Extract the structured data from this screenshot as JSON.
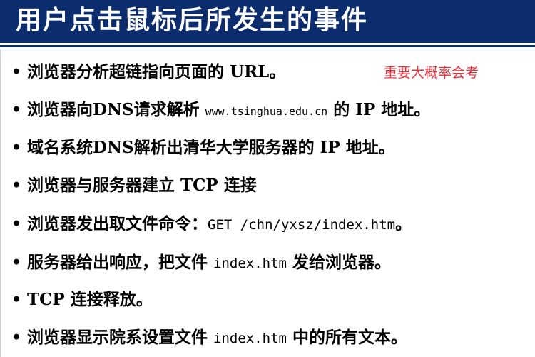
{
  "slide": {
    "title": "用户点击鼠标后所发生的事件",
    "note": "重要大概率会考",
    "bullet_char": "•",
    "bullets": [
      [
        "浏览器分析超链指向页面的 URL。"
      ],
      [
        "浏览器向DNS请求解析 ",
        "www.tsinghua.edu.cn",
        " 的 IP 地址。"
      ],
      [
        "域名系统DNS解析出清华大学服务器的 IP 地址。"
      ],
      [
        "浏览器与服务器建立 TCP 连接"
      ],
      [
        "浏览器发出取文件命令：",
        "GET /chn/yxsz/index.htm",
        "。"
      ],
      [
        "服务器给出响应，把文件 ",
        "index.htm",
        " 发给浏览器。"
      ],
      [
        "TCP 连接释放。"
      ],
      [
        "浏览器显示院系设置文件 ",
        "index.htm",
        " 中的所有文本。"
      ]
    ]
  },
  "colors": {
    "title_bar": "#0b2d6e",
    "title_text": "#ffffff",
    "note_text": "#e8303a",
    "body_text": "#000000"
  }
}
